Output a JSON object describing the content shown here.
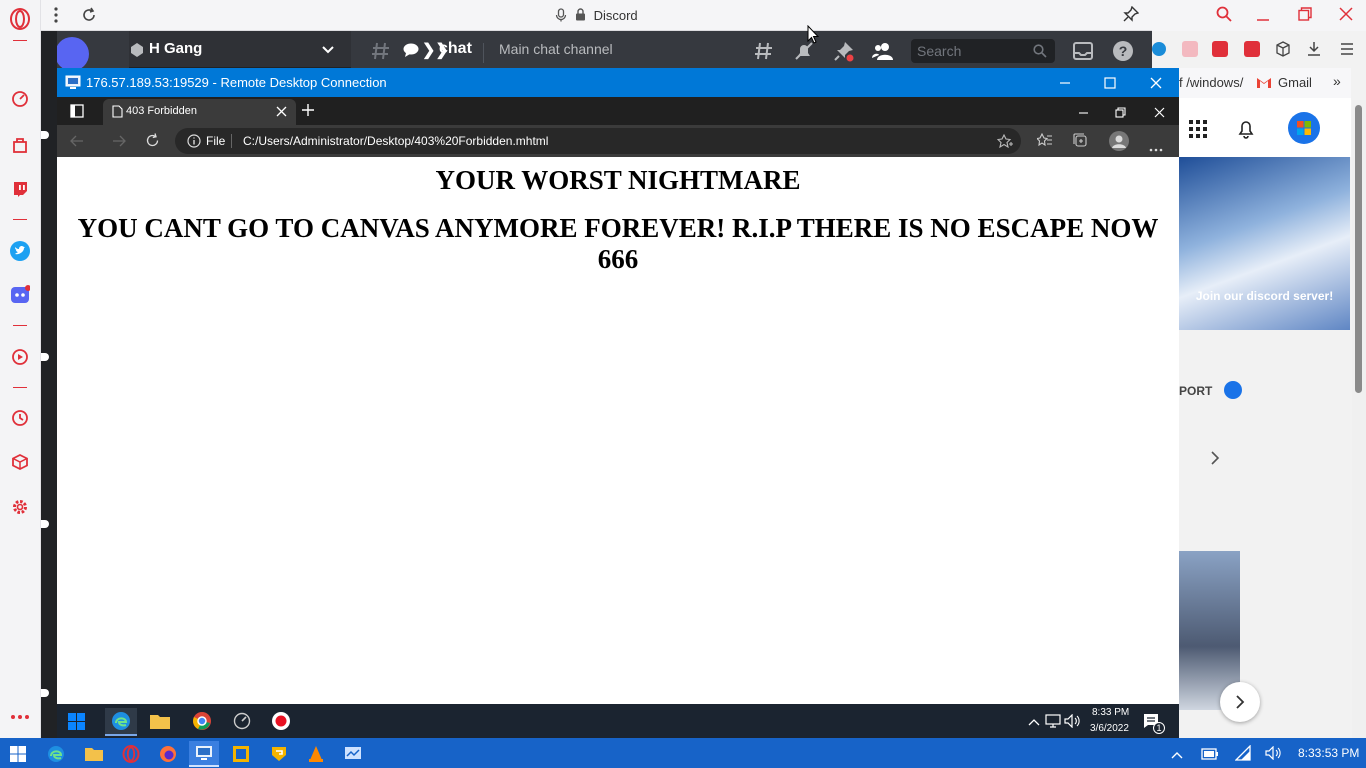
{
  "opera": {
    "tab_title": "Discord",
    "bookmarks": [
      "f /windows/",
      "Gmail"
    ]
  },
  "discord": {
    "server_name": "H Gang",
    "channel_name": "chat",
    "channel_topic": "Main chat channel",
    "search_placeholder": "Search"
  },
  "rdp": {
    "title": "176.57.189.53:19529 - Remote Desktop Connection"
  },
  "edge": {
    "tab_title": "403 Forbidden",
    "addr_scheme": "File",
    "address": "C:/Users/Administrator/Desktop/403%20Forbidden.mhtml"
  },
  "page": {
    "heading": "YOUR WORST NIGHTMARE",
    "message": "YOU CANT GO TO CANVAS ANYMORE FOREVER! R.I.P THERE IS NO ESCAPE NOW 666"
  },
  "remote_taskbar": {
    "time": "8:33 PM",
    "date": "3/6/2022",
    "notification_count": "1"
  },
  "right_page": {
    "discord_join": "Join our discord server!",
    "port_label": "PORT"
  },
  "taskbar": {
    "time": "8:33:53 PM"
  },
  "colors": {
    "rdp_title": "#0078d7",
    "discord_bg": "#36393f",
    "opera_red": "#e0303a",
    "taskbar": "#1763c8"
  }
}
